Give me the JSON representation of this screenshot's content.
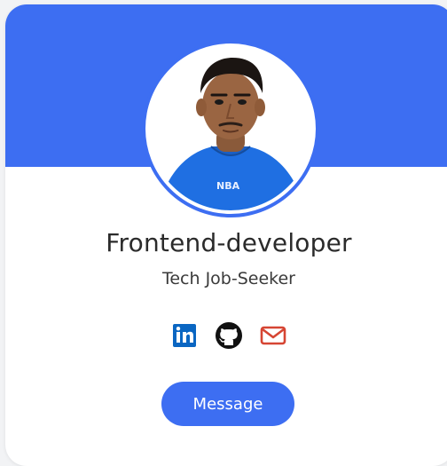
{
  "profile": {
    "title": "Frontend-developer",
    "subtitle": "Tech Job-Seeker",
    "shirt_text": "NBA",
    "avatar_description": "profile photo"
  },
  "social": [
    {
      "icon": "linkedin-icon",
      "color": "#0a66c2"
    },
    {
      "icon": "github-icon",
      "color": "#111111"
    },
    {
      "icon": "mail-icon",
      "color": "#d64533"
    }
  ],
  "actions": {
    "message_label": "Message"
  },
  "colors": {
    "accent": "#3d6ef2",
    "card": "#ffffff",
    "background": "#f2f3f5"
  }
}
